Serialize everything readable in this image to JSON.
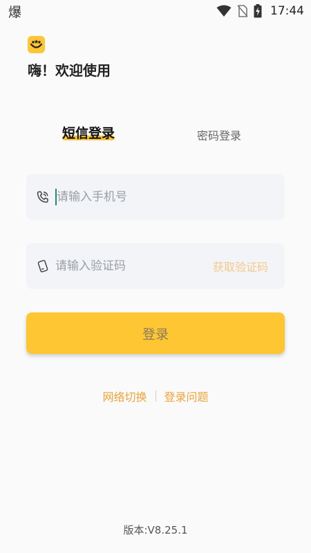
{
  "status_bar": {
    "left_text": "爆",
    "time": "17:44",
    "icons": [
      "wifi-icon",
      "no-sim-icon",
      "battery-charging-icon"
    ]
  },
  "header": {
    "logo_icon": "smiley-logo-icon",
    "greeting": "嗨！欢迎使用"
  },
  "tabs": [
    {
      "label": "短信登录",
      "active": true
    },
    {
      "label": "密码登录",
      "active": false
    }
  ],
  "phone_field": {
    "icon": "phone-icon",
    "placeholder": "请输入手机号",
    "value": ""
  },
  "code_field": {
    "icon": "shield-code-icon",
    "placeholder": "请输入验证码",
    "value": "",
    "get_code_label": "获取验证码"
  },
  "login_button": {
    "label": "登录"
  },
  "links": {
    "network_switch": "网络切换",
    "login_problem": "登录问题"
  },
  "version": "版本:V8.25.1",
  "colors": {
    "accent": "#fdc632",
    "link": "#f0a33a",
    "field_bg": "#f2f4f7"
  }
}
